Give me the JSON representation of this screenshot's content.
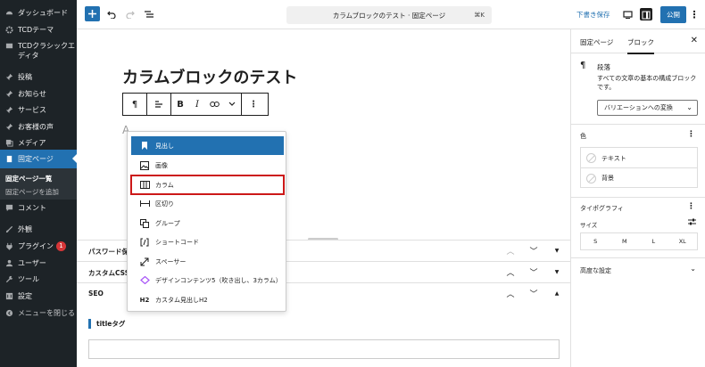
{
  "sidebar": {
    "items": [
      {
        "label": "ダッシュボード",
        "icon": "dashboard-icon"
      },
      {
        "label": "TCDテーマ",
        "icon": "gear-icon"
      },
      {
        "label": "TCDクラシックエディタ",
        "icon": "editor-icon"
      },
      {
        "label": "投稿",
        "icon": "pin-icon"
      },
      {
        "label": "お知らせ",
        "icon": "pin-icon"
      },
      {
        "label": "サービス",
        "icon": "pin-icon"
      },
      {
        "label": "お客様の声",
        "icon": "pin-icon"
      },
      {
        "label": "メディア",
        "icon": "media-icon"
      },
      {
        "label": "固定ページ",
        "icon": "pages-icon"
      },
      {
        "label": "コメント",
        "icon": "comment-icon"
      },
      {
        "label": "外観",
        "icon": "brush-icon"
      },
      {
        "label": "プラグイン",
        "icon": "plugin-icon",
        "badge": "1"
      },
      {
        "label": "ユーザー",
        "icon": "user-icon"
      },
      {
        "label": "ツール",
        "icon": "wrench-icon"
      },
      {
        "label": "設定",
        "icon": "settings-icon"
      },
      {
        "label": "メニューを閉じる",
        "icon": "collapse-icon"
      }
    ],
    "submenu": [
      "固定ページ一覧",
      "固定ページを追加"
    ]
  },
  "toolbar": {
    "document_title": "カラムブロックのテスト · 固定ページ",
    "shortcut": "⌘K",
    "save_draft": "下書き保存",
    "publish": "公開"
  },
  "canvas": {
    "page_title": "カラムブロックのテスト",
    "block_toolbar": {
      "paragraph": "¶",
      "bold": "B",
      "italic": "I"
    },
    "caret": "A"
  },
  "transform_menu": {
    "items": [
      {
        "label": "見出し",
        "icon": "heading-icon"
      },
      {
        "label": "画像",
        "icon": "image-icon"
      },
      {
        "label": "カラム",
        "icon": "columns-icon"
      },
      {
        "label": "区切り",
        "icon": "separator-icon"
      },
      {
        "label": "グループ",
        "icon": "group-icon"
      },
      {
        "label": "ショートコード",
        "icon": "shortcode-icon"
      },
      {
        "label": "スペーサー",
        "icon": "spacer-icon"
      },
      {
        "label": "デザインコンテンツ5（吹き出し、3カラム）",
        "icon": "design-content-icon"
      },
      {
        "label": "カスタム見出しH2",
        "icon": "h2-icon",
        "icon_text": "H2"
      }
    ],
    "selected_index": 0,
    "highlighted_index": 2
  },
  "meta_boxes": {
    "rows": [
      "パスワード保",
      "カスタムCSS",
      "SEO"
    ],
    "title_tag_label": "titleタグ"
  },
  "panel": {
    "tabs": [
      "固定ページ",
      "ブロック"
    ],
    "active_tab": "ブロック",
    "block_icon": "¶",
    "block_name": "段落",
    "block_description": "すべての文章の基本の構成ブロックです。",
    "variation_select": "バリエーションへの変換",
    "color_heading": "色",
    "color_items": [
      "テキスト",
      "背景"
    ],
    "typography_heading": "タイポグラフィ",
    "size_label": "サイズ",
    "sizes": [
      "S",
      "M",
      "L",
      "XL"
    ],
    "advanced": "高度な設定"
  },
  "colors": {
    "accent": "#2271b1",
    "sidebar_bg": "#1d2327",
    "highlight_red": "#cc1818"
  }
}
